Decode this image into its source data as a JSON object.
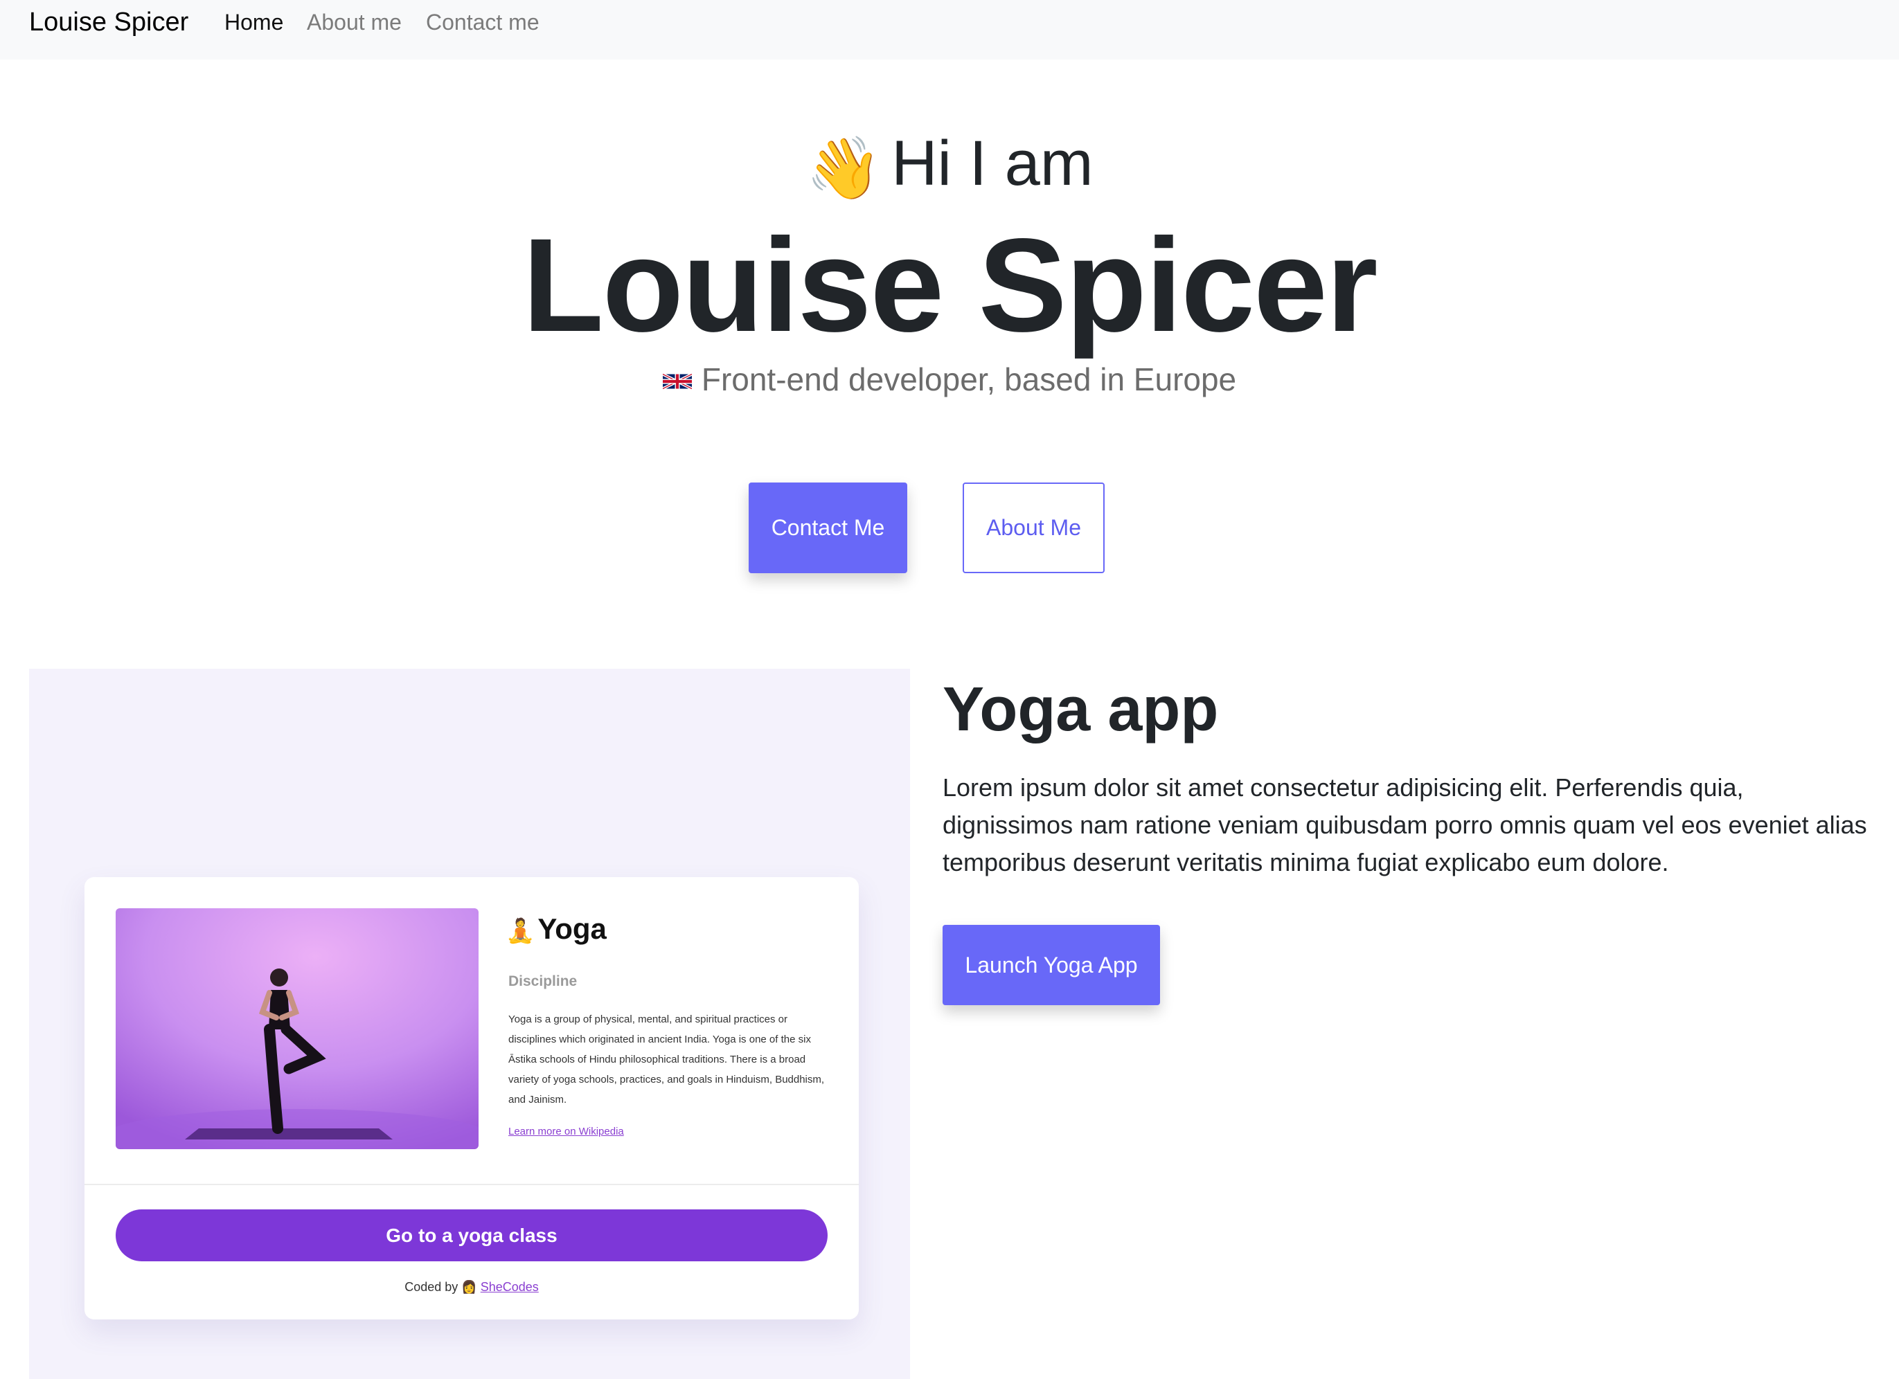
{
  "navbar": {
    "brand": "Louise Spicer",
    "links": [
      {
        "label": "Home",
        "active": true
      },
      {
        "label": "About me",
        "active": false
      },
      {
        "label": "Contact me",
        "active": false
      }
    ]
  },
  "hero": {
    "wave_emoji": "👋",
    "greeting": "Hi I am",
    "name": "Louise Spicer",
    "flag_icon": "uk-flag-icon",
    "subtitle": "Front-end developer, based in Europe",
    "contact_button": "Contact Me",
    "about_button": "About Me"
  },
  "project": {
    "title": "Yoga app",
    "description": "Lorem ipsum dolor sit amet consectetur adipisicing elit. Perferendis quia, dignissimos nam ratione veniam quibusdam porro omnis quam vel eos eveniet alias temporibus deserunt veritatis minima fugiat explicabo eum dolore.",
    "launch_button": "Launch Yoga App",
    "preview_card": {
      "title_emoji": "🧘",
      "title": "Yoga",
      "label": "Discipline",
      "text": "Yoga is a group of physical, mental, and spiritual practices or disciplines which originated in ancient India. Yoga is one of the six Āstika schools of Hindu philosophical traditions. There is a broad variety of yoga schools, practices, and goals in Hinduism, Buddhism, and Jainism.",
      "link": "Learn more on Wikipedia",
      "button": "Go to a yoga class",
      "credit_prefix": "Coded by",
      "credit_emoji": "👩",
      "credit_link": "SheCodes"
    }
  },
  "colors": {
    "accent": "#6868f8",
    "navbar_bg": "#f8f9fa",
    "panel_bg": "#f4f2fc",
    "card_button": "#7d37d8"
  }
}
